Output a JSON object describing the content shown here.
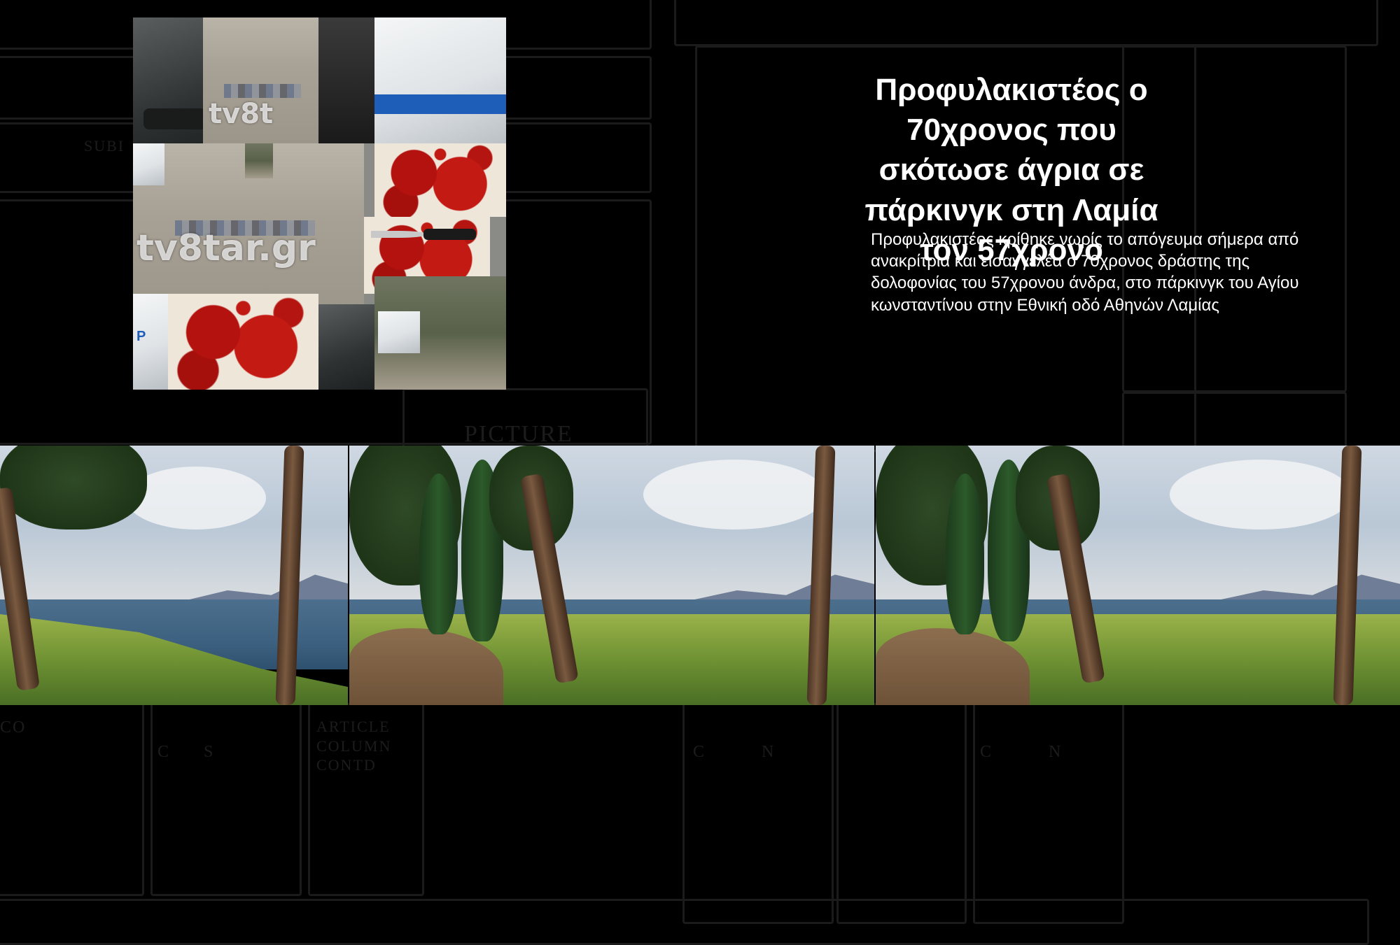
{
  "article": {
    "headline": "Προφυλακιστέος ο 70χρονος που σκότωσε άγρια σε πάρκινγκ στη Λαμία τον 57χρονο",
    "lead": "Προφυλακιστέος κρίθηκε νωρίς το απόγευμα σήμερα από ανακρίτρια και εισαγγελέα ο 70χρονος δράστης της δολοφονίας του 57χρονου άνδρα, στο πάρκινγκ του Αγίου κωνσταντίνου στην Εθνική οδό Αθηνών Λαμίας"
  },
  "collage": {
    "watermark_small": "tv8t",
    "watermark_large": "tv8tar.gr"
  },
  "background_layout_text": {
    "sub": "SUBI",
    "picture": "PICTURE",
    "article_column": "ARTICLE COLUMN CONTD",
    "col1": "CO",
    "col2": "C      S",
    "col3": "C          N",
    "col4": "C          N"
  }
}
